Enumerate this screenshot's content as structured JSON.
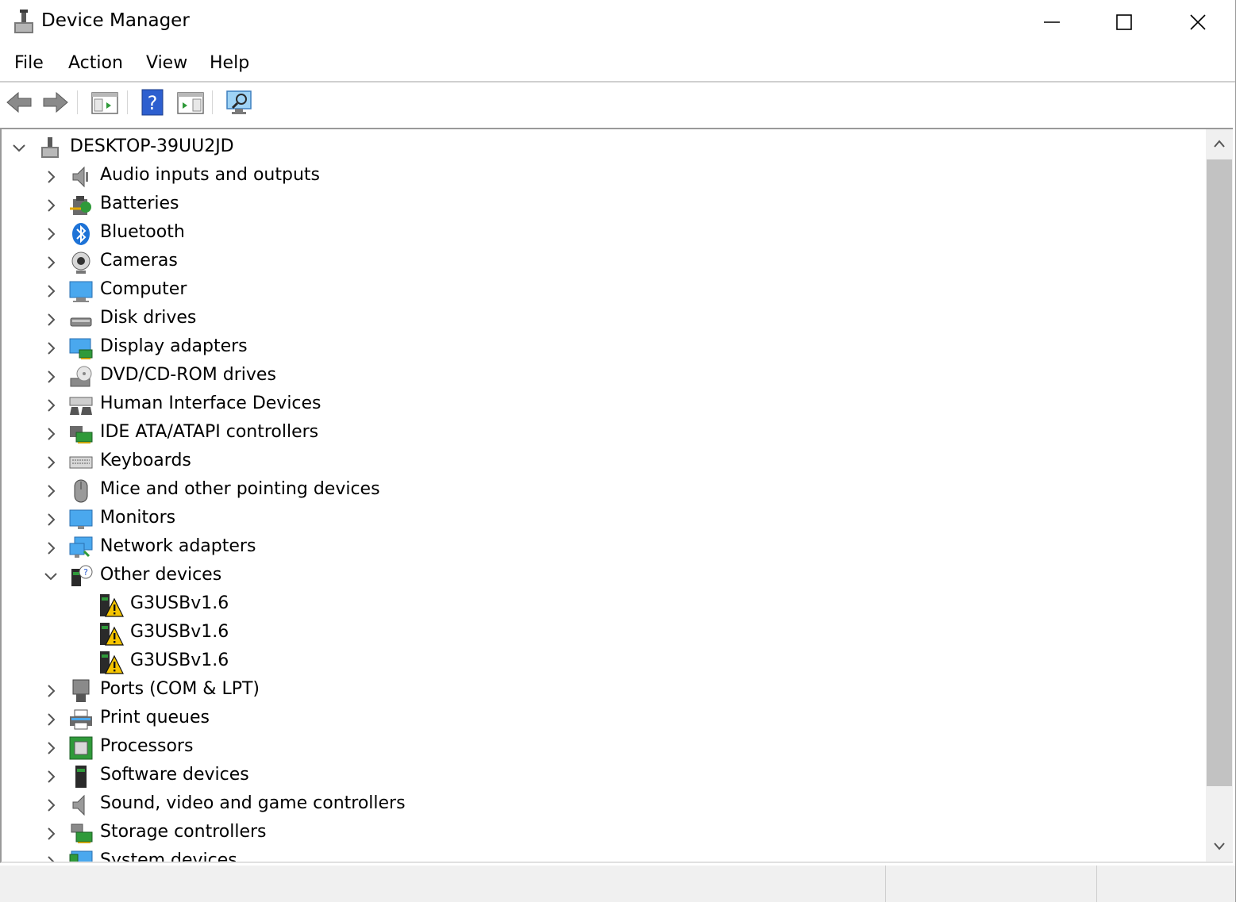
{
  "window": {
    "title": "Device Manager"
  },
  "menu": [
    "File",
    "Action",
    "View",
    "Help"
  ],
  "tree": {
    "root": "DESKTOP-39UU2JD",
    "categories": [
      {
        "label": "Audio inputs and outputs",
        "icon": "speaker-icon"
      },
      {
        "label": "Batteries",
        "icon": "battery-icon"
      },
      {
        "label": "Bluetooth",
        "icon": "bluetooth-icon"
      },
      {
        "label": "Cameras",
        "icon": "camera-icon"
      },
      {
        "label": "Computer",
        "icon": "computer-icon"
      },
      {
        "label": "Disk drives",
        "icon": "disk-drive-icon"
      },
      {
        "label": "Display adapters",
        "icon": "display-adapter-icon"
      },
      {
        "label": "DVD/CD-ROM drives",
        "icon": "dvd-drive-icon"
      },
      {
        "label": "Human Interface Devices",
        "icon": "hid-icon"
      },
      {
        "label": "IDE ATA/ATAPI controllers",
        "icon": "ide-controller-icon"
      },
      {
        "label": "Keyboards",
        "icon": "keyboard-icon"
      },
      {
        "label": "Mice and other pointing devices",
        "icon": "mouse-icon"
      },
      {
        "label": "Monitors",
        "icon": "monitor-icon"
      },
      {
        "label": "Network adapters",
        "icon": "network-adapter-icon"
      },
      {
        "label": "Other devices",
        "icon": "other-devices-icon",
        "expanded": true,
        "children": [
          "G3USBv1.6",
          "G3USBv1.6",
          "G3USBv1.6"
        ]
      },
      {
        "label": "Ports (COM & LPT)",
        "icon": "port-icon"
      },
      {
        "label": "Print queues",
        "icon": "printer-icon"
      },
      {
        "label": "Processors",
        "icon": "processor-icon"
      },
      {
        "label": "Software devices",
        "icon": "software-device-icon"
      },
      {
        "label": "Sound, video and game controllers",
        "icon": "sound-controller-icon"
      },
      {
        "label": "Storage controllers",
        "icon": "storage-controller-icon"
      },
      {
        "label": "System devices",
        "icon": "system-devices-icon"
      }
    ]
  },
  "colors": {
    "accent": "#1e73d7",
    "warning": "#f5c400",
    "chip_green": "#2f9a3a"
  }
}
